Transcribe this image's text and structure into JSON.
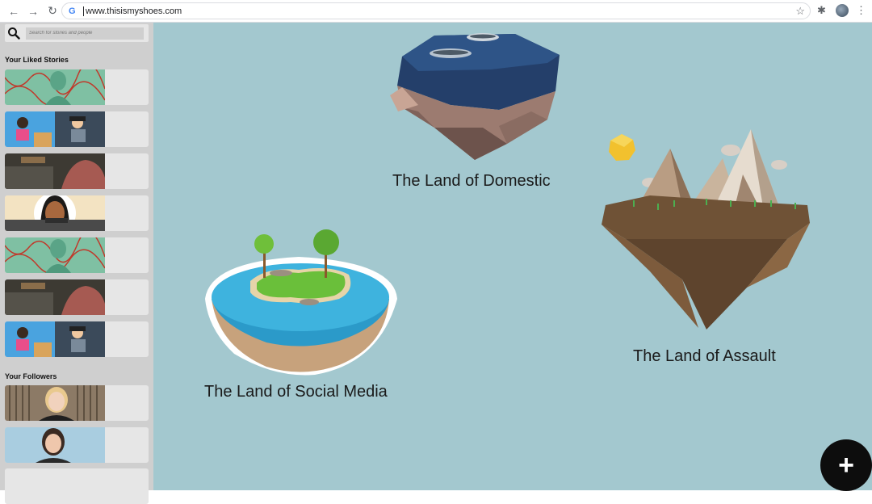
{
  "browser": {
    "url": "www.thisismyshoes.com"
  },
  "sidebar": {
    "search_placeholder": "Search for stories and people",
    "liked_title": "Your Liked Stories",
    "followers_title": "Your Followers"
  },
  "lands": [
    {
      "label": "The Land of Domestic"
    },
    {
      "label": "The Land of Assault"
    },
    {
      "label": "The Land of Social Media"
    }
  ],
  "fab": {
    "symbol": "+"
  },
  "colors": {
    "main_bg": "#a3c8cf",
    "sidebar_bg": "#cfcfcf",
    "card_bg": "#e6e6e6",
    "fab_bg": "#0d0d0d"
  }
}
